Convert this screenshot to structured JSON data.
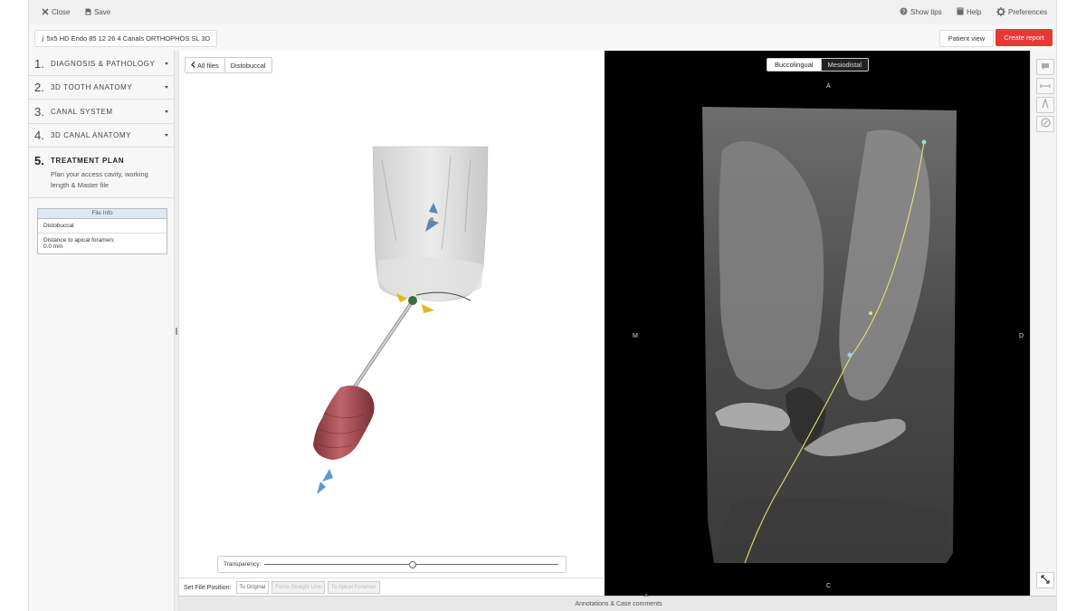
{
  "topbar": {
    "close_label": "Close",
    "save_label": "Save",
    "tips_label": "Show tips",
    "help_label": "Help",
    "preferences_label": "Preferences"
  },
  "case": {
    "title": "5x5 HD Endo 85 12 26 4 Canals ORTHOPHOS SL 3D"
  },
  "actions": {
    "patient_view": "Patient view",
    "create_report": "Create report"
  },
  "steps": [
    {
      "num": "1.",
      "label": "DIAGNOSIS & PATHOLOGY"
    },
    {
      "num": "2.",
      "label": "3D TOOTH ANATOMY"
    },
    {
      "num": "3.",
      "label": "CANAL SYSTEM"
    },
    {
      "num": "4.",
      "label": "3D CANAL ANATOMY"
    },
    {
      "num": "5.",
      "label": "TREATMENT PLAN",
      "description": "Plan your access cavity, working length & Master file"
    }
  ],
  "file_info": {
    "header": "File Info",
    "file_name": "Distobuccal",
    "distance_label": "Distance to apical foramen:",
    "distance_value": "0.0 mm"
  },
  "viewer3d": {
    "back_label": "All files",
    "current_file": "Distobuccal",
    "transparency_label": "Transparency:",
    "transparency_value": 0.5
  },
  "set_position": {
    "label": "Set File Position:",
    "to_original": "To Original",
    "force_straight": "Force Straight Line",
    "to_apical": "To Apical Foramen"
  },
  "ct_view": {
    "tab_active": "Buccolingual",
    "tab_inactive": "Mesiodistal",
    "orient_top": "A",
    "orient_left": "M",
    "orient_right": "D",
    "orient_bottom": "C"
  },
  "bottom": {
    "label": "Annotations & Case comments"
  },
  "colors": {
    "accent_red": "#e53935",
    "file_handle": "#b04a4e",
    "ct_path": "#e8df6a",
    "marker_blue": "#5b9bd5",
    "marker_yellow": "#e2b81a"
  },
  "icons": [
    "close-icon",
    "save-icon",
    "help-circle-icon",
    "book-icon",
    "gear-icon",
    "info-icon",
    "chevron-left-icon",
    "comment-icon",
    "measure-icon",
    "angle-icon",
    "compass-icon",
    "expand-icon"
  ]
}
